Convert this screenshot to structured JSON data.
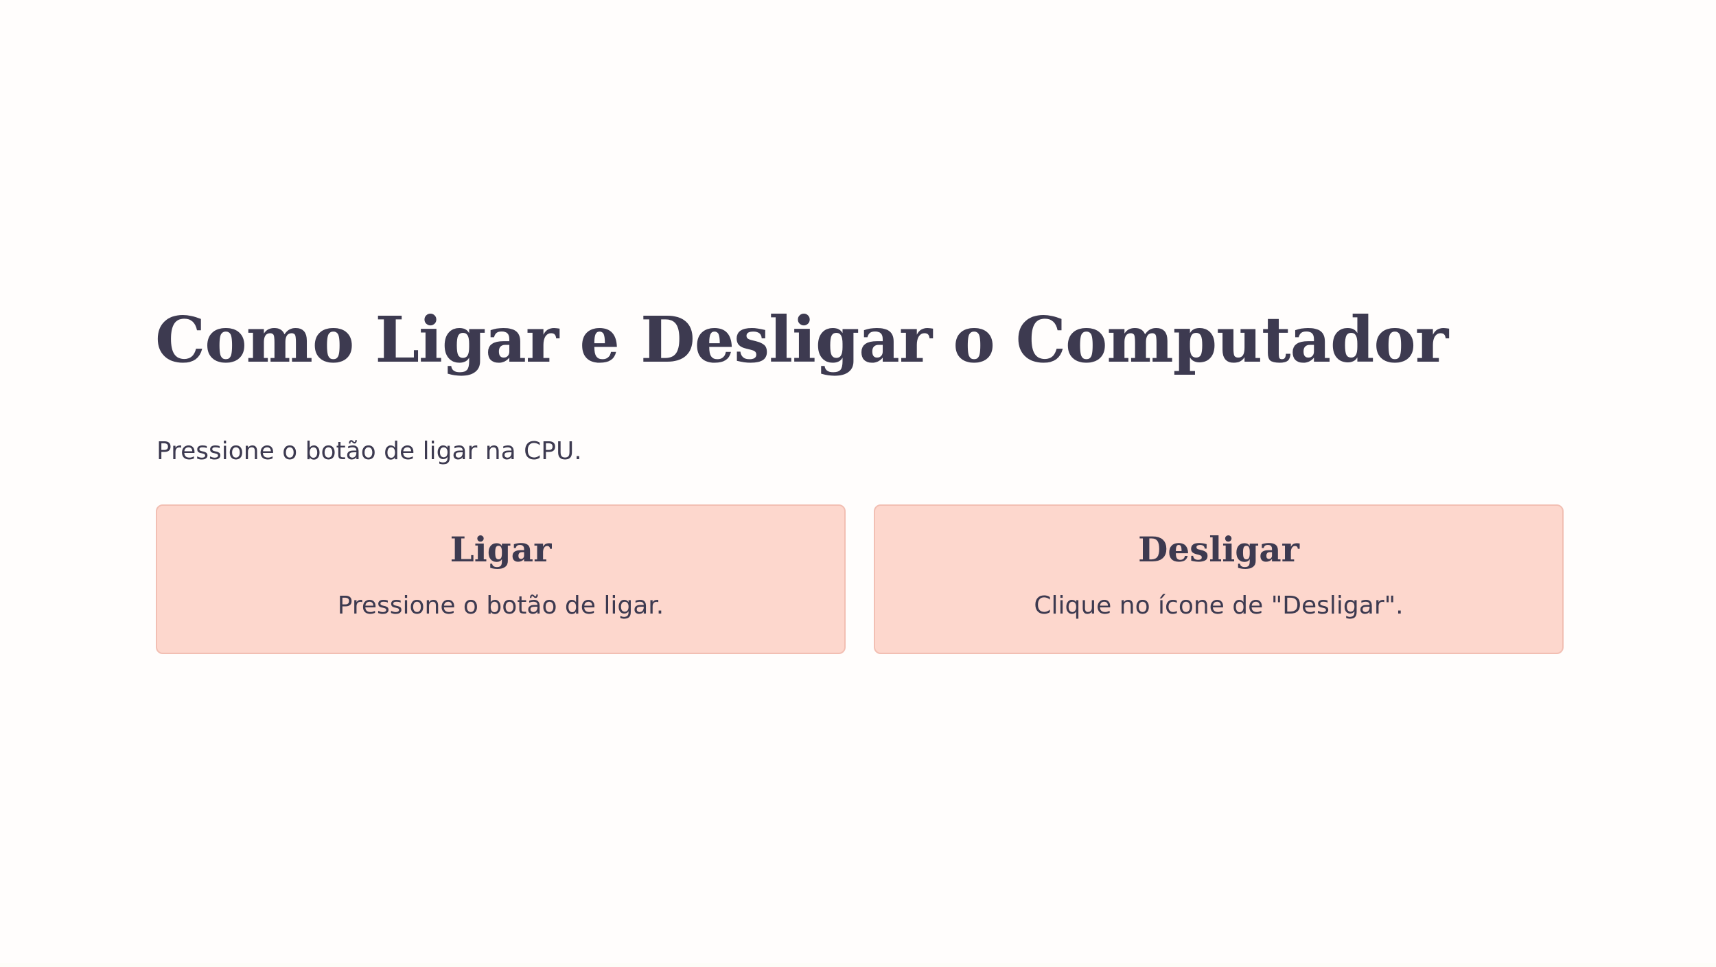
{
  "page": {
    "title": "Como Ligar e Desligar o Computador",
    "subtitle": "Pressione o botão de ligar na CPU."
  },
  "cards": [
    {
      "title": "Ligar",
      "text": "Pressione o botão de ligar."
    },
    {
      "title": "Desligar",
      "text": "Clique no ícone de \"Desligar\"."
    }
  ],
  "colors": {
    "background": "#fffdfc",
    "text": "#3d3a50",
    "card_background": "#fdd7cd",
    "card_border": "#f2bfb3"
  }
}
